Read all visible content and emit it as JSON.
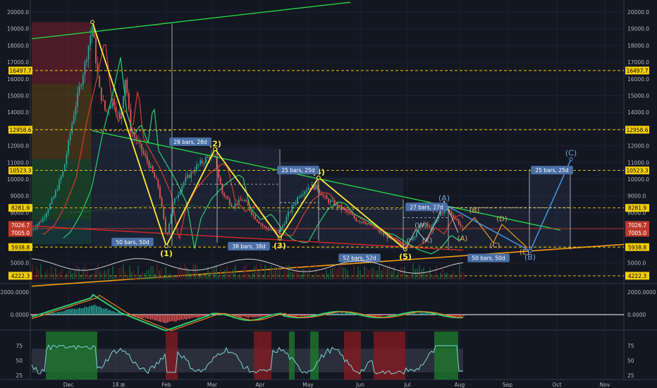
{
  "chart_data": [
    {
      "type": "candlestick",
      "panel": "price",
      "ylim": [
        3500,
        20500
      ],
      "y_ticks": [
        5000,
        6000,
        7000,
        8000,
        9000,
        10000,
        11000,
        12000,
        13000,
        14000,
        15000,
        16000,
        17000,
        18000,
        19000,
        20000
      ],
      "y_tick_labels": [
        "5000.0",
        "6000.0",
        "7000.0",
        "8000.0",
        "9000.0",
        "10000.0",
        "11000.0",
        "12000.0",
        "13000.0",
        "14000.0",
        "15000.0",
        "16000.0",
        "17000.0",
        "18000.0",
        "19000.0",
        "20000.0"
      ],
      "x_ticks": [
        "Dec",
        "18",
        "Feb",
        "Mar",
        "Apr",
        "May",
        "Jun",
        "Jul",
        "Aug",
        "Sep",
        "Oct",
        "Nov"
      ],
      "price_lines": [
        {
          "label": "16497.7",
          "value": 16497.7,
          "color": "#f5d000"
        },
        {
          "label": "12958.6",
          "value": 12958.6,
          "color": "#f5d000"
        },
        {
          "label": "10523.3",
          "value": 10523.3,
          "color": "#f5d000"
        },
        {
          "label": "8281.9",
          "value": 8281.9,
          "color": "#f5d000"
        },
        {
          "label": "5938.8",
          "value": 5938.8,
          "color": "#f5d000"
        },
        {
          "label": "4222.3",
          "value": 4222.3,
          "color": "#f5d000"
        }
      ],
      "current_price_labels": [
        {
          "label": "7026.7",
          "value": 7026.7,
          "color": "#c0392b"
        },
        {
          "label": "7005.0",
          "value": 7005.0,
          "color": "#c0392b"
        }
      ],
      "wave_points": [
        {
          "label": "",
          "date": "2017-12-17",
          "value": 19400
        },
        {
          "label": "(1)",
          "date": "2018-02-06",
          "value": 6000
        },
        {
          "label": "(2)",
          "date": "2018-03-05",
          "value": 11800
        },
        {
          "label": "(3)",
          "date": "2018-04-06",
          "value": 6450
        },
        {
          "label": "(4)",
          "date": "2018-05-06",
          "value": 10100
        },
        {
          "label": "(5)",
          "date": "2018-06-29",
          "value": 5800
        }
      ],
      "wave_labels_small": [
        "(W)",
        "(X)",
        "(Y)",
        "(A)",
        "(B)",
        "(C)",
        "(D)",
        "(E)"
      ],
      "projection_points": [
        {
          "label": "(A)",
          "value": 8500
        },
        {
          "label": "(B)",
          "value": 5700
        },
        {
          "label": "(C)",
          "value": 11200
        }
      ],
      "bar_count_labels": [
        "28 bars, 28d",
        "50 bars, 50d",
        "38 bars, 38d",
        "25 bars, 25d",
        "52 bars, 52d",
        "27 bars, 27d",
        "50 bars, 50d",
        "25 bars, 25d"
      ]
    },
    {
      "type": "histogram",
      "panel": "macd",
      "y_ticks": [
        2000,
        0
      ],
      "y_tick_labels": [
        "2000.0000",
        "0.0000"
      ]
    },
    {
      "type": "line",
      "panel": "oscillator",
      "y_ticks": [
        75,
        50,
        25
      ],
      "y_tick_labels": [
        "75",
        "50",
        "25"
      ]
    }
  ]
}
